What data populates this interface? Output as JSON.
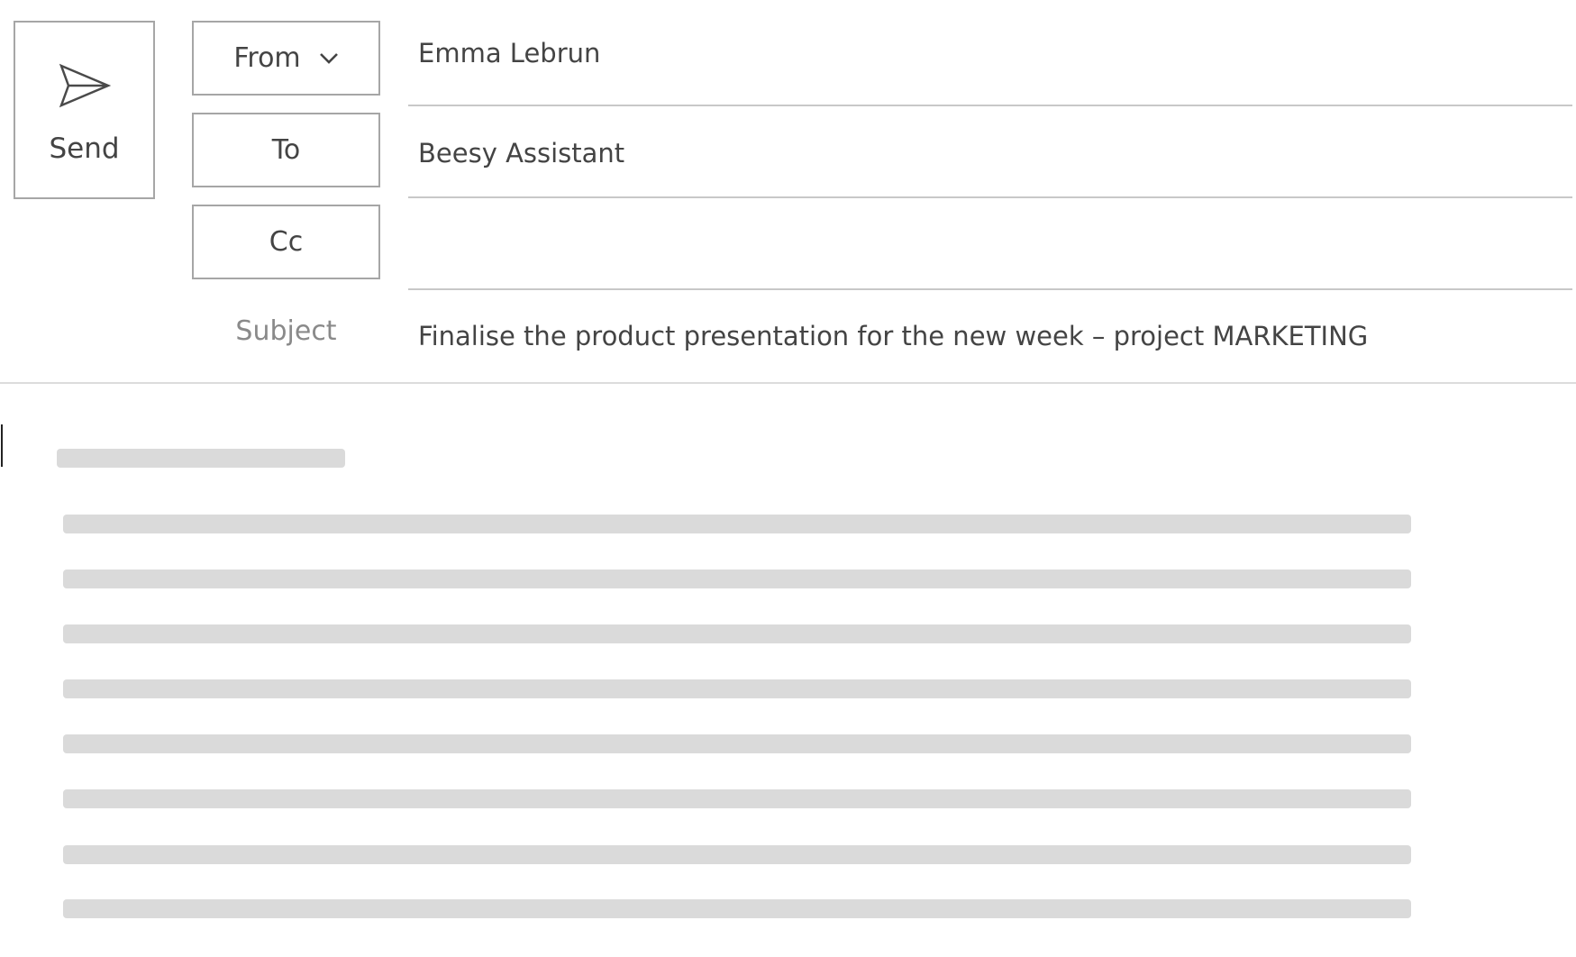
{
  "compose": {
    "send_label": "Send",
    "from_label": "From",
    "to_label": "To",
    "cc_label": "Cc",
    "subject_label": "Subject",
    "from_value": "Emma Lebrun",
    "to_value": "Beesy Assistant",
    "cc_value": "",
    "subject_value": "Finalise the product presentation for the new week – project MARKETING"
  },
  "icons": {
    "send": "send-paper-plane-icon",
    "from_dropdown": "chevron-down-icon"
  },
  "colors": {
    "border": "#a6a6a6",
    "text": "#444444",
    "label_muted": "#8a8a8a",
    "skeleton": "#dadada"
  }
}
